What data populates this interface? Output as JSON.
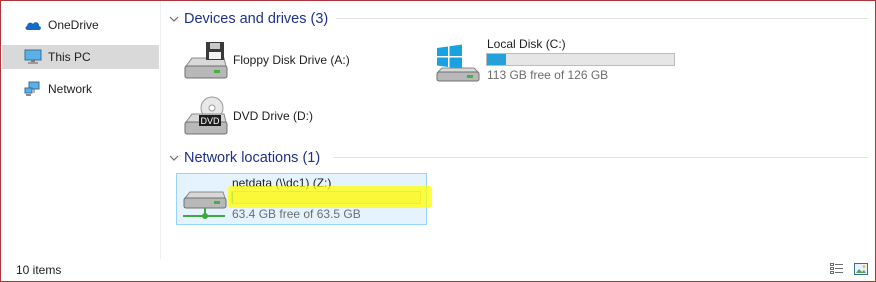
{
  "sidebar": {
    "items": [
      {
        "label": "OneDrive",
        "icon": "onedrive-icon"
      },
      {
        "label": "This PC",
        "icon": "computer-icon",
        "selected": true
      },
      {
        "label": "Network",
        "icon": "network-icon"
      }
    ]
  },
  "groups": {
    "devices": {
      "title": "Devices and drives (3)",
      "drives": [
        {
          "name": "Floppy Disk Drive (A:)",
          "icon": "floppy-drive-icon"
        },
        {
          "name": "Local Disk (C:)",
          "icon": "windows-drive-icon",
          "free_text": "113 GB free of 126 GB",
          "used_fraction": 0.103
        },
        {
          "name": "DVD Drive (D:)",
          "icon": "dvd-drive-icon",
          "badge": "DVD"
        }
      ]
    },
    "network": {
      "title": "Network locations (1)",
      "drives": [
        {
          "name": "netdata (\\\\dc1) (Z:)",
          "icon": "network-drive-icon",
          "free_text": "63.4 GB free of 63.5 GB",
          "used_fraction": 0.002
        }
      ]
    }
  },
  "status": {
    "item_count": "10 items",
    "view_buttons": [
      "details-view-icon",
      "large-icons-view-icon"
    ]
  },
  "colors": {
    "accent": "#26a0da",
    "header_text": "#1e3287",
    "highlight": "#ffff00",
    "selected_row": "#d9d9d9",
    "window_border": "#b0343c"
  }
}
